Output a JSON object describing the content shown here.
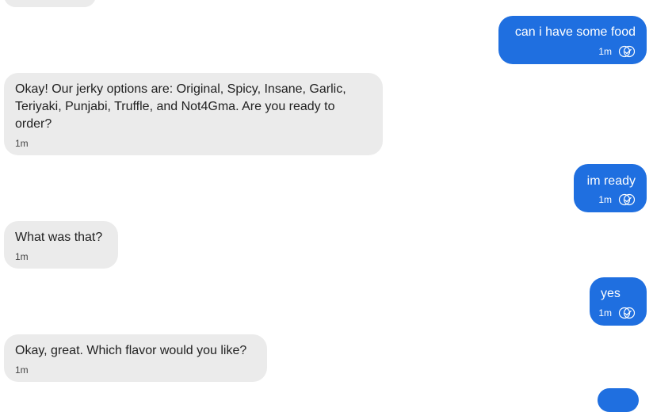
{
  "colors": {
    "bot_bubble": "#ebebeb",
    "user_bubble": "#1f6fe0",
    "bot_text": "#222222",
    "user_text": "#ffffff"
  },
  "icons": {
    "read_receipt": "double-check-circle-icon"
  },
  "messages": [
    {
      "sender": "user",
      "text": "can i have some food",
      "time": "1m"
    },
    {
      "sender": "bot",
      "text": "Okay! Our jerky options are: Original, Spicy, Insane, Garlic, Teriyaki, Punjabi, Truffle, and Not4Gma. Are you ready to order?",
      "time": "1m"
    },
    {
      "sender": "user",
      "text": "im ready",
      "time": "1m"
    },
    {
      "sender": "bot",
      "text": "What was that?",
      "time": "1m"
    },
    {
      "sender": "user",
      "text": "yes",
      "time": "1m"
    },
    {
      "sender": "bot",
      "text": "Okay, great. Which flavor would you like?",
      "time": "1m"
    }
  ]
}
